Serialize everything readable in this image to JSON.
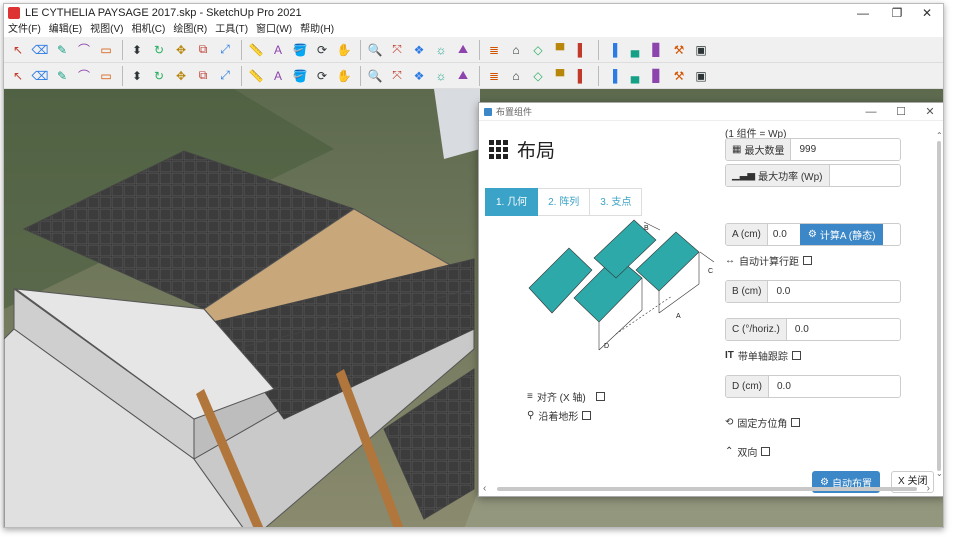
{
  "window": {
    "title": "LE CYTHELIA PAYSAGE 2017.skp - SketchUp Pro 2021",
    "controls": {
      "minimize": "—",
      "maximize": "❐",
      "close": "✕"
    }
  },
  "menu": [
    "文件(F)",
    "编辑(E)",
    "视图(V)",
    "相机(C)",
    "绘图(R)",
    "工具(T)",
    "窗口(W)",
    "帮助(H)"
  ],
  "toolbar1": [
    "arrow-icon",
    "eraser-icon",
    "pencil-icon",
    "arc-icon",
    "rectangle-icon",
    "push-pull-icon",
    "rotate-icon",
    "move-icon",
    "offset-icon",
    "scale-icon",
    "tape-icon",
    "text-icon",
    "paint-icon",
    "orbit-icon",
    "pan-icon",
    "zoom-icon",
    "zoom-extents-icon",
    "component-icon",
    "solar-icon",
    "terrain-icon",
    "layers-icon",
    "warehouse-icon",
    "iso-icon",
    "top-icon",
    "front-icon",
    "right-icon",
    "back-icon",
    "left-icon",
    "extension-icon",
    "sandbox-icon"
  ],
  "toolbar2": [
    "plugin-a",
    "plugin-b",
    "plugin-c",
    "plugin-d",
    "plugin-e",
    "info-icon",
    "plugin-f",
    "plugin-g",
    "plugin-h",
    "plugin-i",
    "plugin-j",
    "plugin-k",
    "eye-icon",
    "ruler-icon",
    "plugin-l",
    "solid-a",
    "solid-b",
    "solid-c",
    "solid-d",
    "solid-e",
    "solid-f",
    "solid-g",
    "style-a",
    "style-b",
    "style-c",
    "style-d",
    "style-e",
    "style-f",
    "style-g",
    "style-h"
  ],
  "dialog": {
    "title": "布置组件",
    "heading": "布局",
    "tabs": [
      "1. 几何",
      "2. 阵列",
      "3. 支点"
    ],
    "active_tab": 0,
    "unit_note": "(1 组件 = Wp)",
    "max_count_label": "最大数量",
    "max_count_value": "999",
    "max_power_label": "最大功率 (Wp)",
    "max_power_value": "",
    "a_label": "A (cm)",
    "a_value": "0.0",
    "calc_a_label": "计算A (静态)",
    "auto_row_label": "自动计算行距",
    "b_label": "B (cm)",
    "b_value": "0.0",
    "c_label": "C (°/horiz.)",
    "c_value": "0.0",
    "single_axis_label": "带单轴跟踪",
    "d_label": "D (cm)",
    "d_value": "0.0",
    "fixed_azimuth_label": "固定方位角",
    "bidirectional_label": "双向",
    "align_label": "对齐 (X 轴)",
    "follow_terrain_label": "沿着地形",
    "auto_place_label": "自动布置",
    "close_label": "X 关闭",
    "diagram_labels": {
      "a": "A",
      "b": "B",
      "c": "C",
      "d": "D"
    }
  },
  "colors": {
    "accent": "#3ba3c7",
    "button": "#3b87c7",
    "panel": "#2ea9a9",
    "roof": "#c8a87a"
  }
}
